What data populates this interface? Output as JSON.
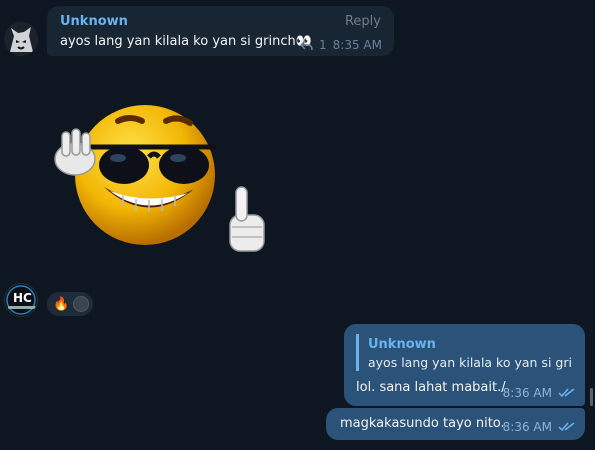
{
  "incoming": {
    "sender": "Unknown",
    "reply_label": "Reply",
    "text": "ayos lang yan kilala ko yan si grinch👀",
    "reply_count": "1",
    "time": "8:35 AM"
  },
  "sticker": {
    "icon": "sunglasses-thumbs-up-smiley-sticker"
  },
  "reactions": {
    "emoji": "🔥",
    "avatar_icon": "reactor-avatar"
  },
  "outgoing": [
    {
      "quote_name": "Unknown",
      "quote_text": "ayos lang yan kilala ko yan si grin...",
      "text": "lol. sana lahat mabait./",
      "time": "8:36 AM"
    },
    {
      "text": "magkakasundo tayo nito.",
      "time": "8:36 AM"
    }
  ],
  "avatars": {
    "top_icon": "wolf-avatar",
    "bottom_text": "HC"
  },
  "colors": {
    "background": "#0e1621",
    "incoming_bubble": "#182533",
    "outgoing_bubble": "#2b5278",
    "sender_name": "#6ab3f3"
  }
}
